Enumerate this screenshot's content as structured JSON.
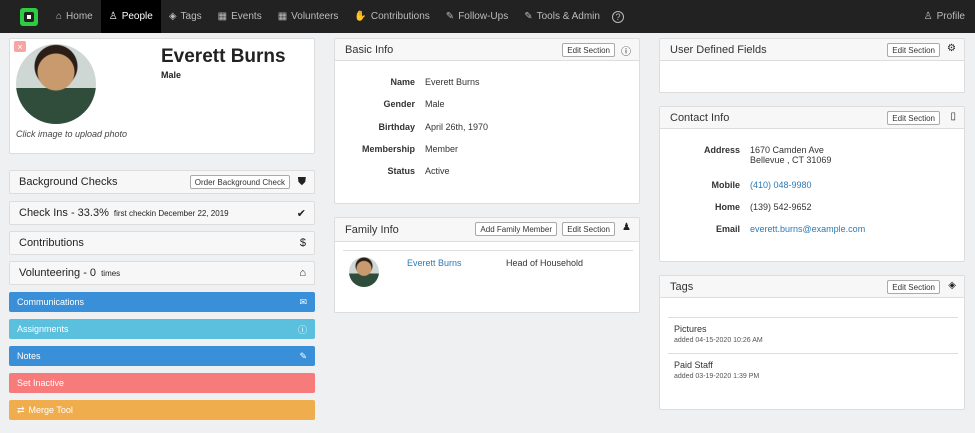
{
  "nav": {
    "items": [
      {
        "label": "Home",
        "icon": "home-icon",
        "glyph": "⌂"
      },
      {
        "label": "People",
        "icon": "user-icon",
        "glyph": "♙"
      },
      {
        "label": "Tags",
        "icon": "tags-icon",
        "glyph": "◈"
      },
      {
        "label": "Events",
        "icon": "calendar-icon",
        "glyph": "▦"
      },
      {
        "label": "Volunteers",
        "icon": "calendar-icon",
        "glyph": "▦"
      },
      {
        "label": "Contributions",
        "icon": "hand-icon",
        "glyph": "✋"
      },
      {
        "label": "Follow-Ups",
        "icon": "wrench-icon",
        "glyph": "✎"
      },
      {
        "label": "Tools & Admin",
        "icon": "wrench-icon",
        "glyph": "✎"
      }
    ],
    "help": "?",
    "profile_label": "Profile"
  },
  "person": {
    "name": "Everett Burns",
    "gender": "Male",
    "upload_hint": "Click image to upload photo",
    "delete_glyph": "×"
  },
  "left": {
    "background_checks": {
      "label": "Background Checks",
      "button": "Order Background Check"
    },
    "check_ins": {
      "label": "Check Ins - 33.3%",
      "detail": "first checkin December 22, 2019"
    },
    "contributions": {
      "label": "Contributions"
    },
    "volunteering": {
      "label": "Volunteering - 0",
      "detail": "times"
    },
    "communications": "Communications",
    "assignments": "Assignments",
    "notes": "Notes",
    "set_inactive": "Set Inactive",
    "merge_tool": "Merge Tool"
  },
  "basic_info": {
    "title": "Basic Info",
    "edit": "Edit Section",
    "rows": [
      {
        "k": "Name",
        "v": "Everett Burns"
      },
      {
        "k": "Gender",
        "v": "Male"
      },
      {
        "k": "Birthday",
        "v": "April 26th, 1970"
      },
      {
        "k": "Membership",
        "v": "Member"
      },
      {
        "k": "Status",
        "v": "Active"
      }
    ]
  },
  "family_info": {
    "title": "Family Info",
    "add": "Add Family Member",
    "edit": "Edit Section",
    "member_name": "Everett Burns",
    "member_role": "Head of Household"
  },
  "user_defined": {
    "title": "User Defined Fields",
    "edit": "Edit Section"
  },
  "contact_info": {
    "title": "Contact Info",
    "edit": "Edit Section",
    "address_label": "Address",
    "address_line1": "1670 Camden Ave",
    "address_line2": "Bellevue , CT 31069",
    "mobile_label": "Mobile",
    "mobile": "(410) 048-9980",
    "home_label": "Home",
    "home": "(139) 542-9652",
    "email_label": "Email",
    "email": "everett.burns@example.com"
  },
  "tags": {
    "title": "Tags",
    "edit": "Edit Section",
    "items": [
      {
        "name": "Pictures",
        "added": "added 04-15-2020 10:26 AM"
      },
      {
        "name": "Paid Staff",
        "added": "added 03-19-2020 1:39 PM"
      }
    ]
  },
  "colors": {
    "communications": "#3a8fd9",
    "assignments": "#5bc0de",
    "notes": "#3a8fd9",
    "set_inactive": "#f77b7b",
    "merge_tool": "#f0ad4e"
  }
}
